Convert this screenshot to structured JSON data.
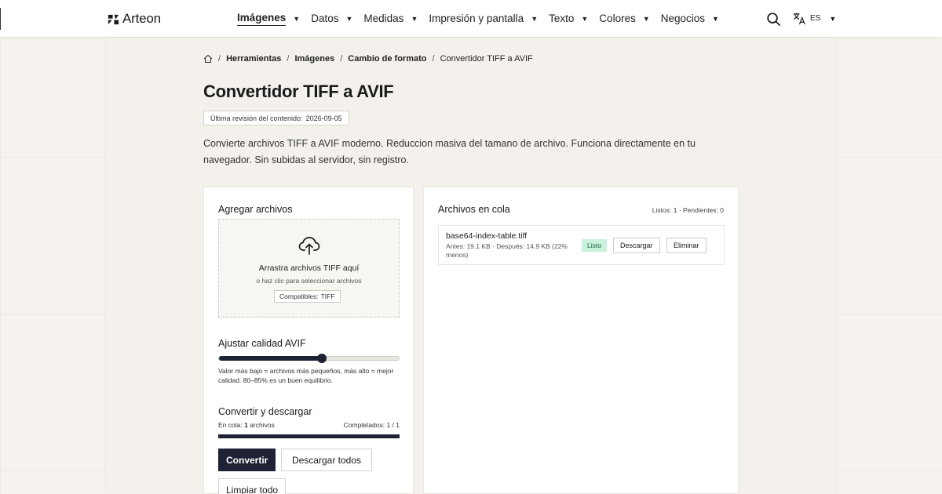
{
  "brand": {
    "name": "Arteon"
  },
  "nav": {
    "items": [
      {
        "label": "Imágenes",
        "active": true
      },
      {
        "label": "Datos"
      },
      {
        "label": "Medidas"
      },
      {
        "label": "Impresión y pantalla"
      },
      {
        "label": "Texto"
      },
      {
        "label": "Colores"
      },
      {
        "label": "Negocios"
      }
    ],
    "caret": "▼",
    "language": "ES"
  },
  "breadcrumb": [
    "Herramientas",
    "Imágenes",
    "Cambio de formato",
    "Convertidor TIFF a AVIF"
  ],
  "page": {
    "title": "Convertidor TIFF a AVIF",
    "revision_label": "Última revisión del contenido:",
    "revision_date": "2026-09-05",
    "intro": "Convierte archivos TIFF a AVIF moderno. Reduccion masiva del tamano de archivo. Funciona directamente en tu navegador. Sin subidas al servidor, sin registro."
  },
  "upload": {
    "title": "Agregar archivos",
    "drop_title": "Arrastra archivos TIFF aquí",
    "drop_sub": "o haz clic para seleccionar archivos",
    "compat_label": "Compatibles:",
    "compat_value": "TIFF"
  },
  "quality": {
    "title": "Ajustar calidad AVIF",
    "slider_fraction": 0.57,
    "help": "Valor más bajo = archivos más pequeños, más alto = mejor calidad. 80–85% es un buen equilibrio."
  },
  "convert": {
    "title": "Convertir y descargar",
    "queued_label": "En cola:",
    "queued_count": "1",
    "queued_suffix": "archivos",
    "completed_label": "Completados:",
    "completed_value": "1 / 1",
    "progress_fraction": 1.0,
    "convert_btn": "Convertir",
    "download_all_btn": "Descargar todos",
    "clear_btn": "Limpiar todo"
  },
  "queue": {
    "title": "Archivos en cola",
    "status": "Listos: 1 · Pendientes: 0",
    "files": [
      {
        "name": "base64-index-table.tiff",
        "sizes": "Antes: 19.1 KB · Después: 14.9 KB (22% menos)",
        "status": "Listo",
        "download_btn": "Descargar",
        "remove_btn": "Eliminar"
      }
    ]
  },
  "colors": {
    "accent": "#1f2235",
    "ready_bg": "#c9f2dd",
    "page_bg": "#f6f3ee"
  }
}
